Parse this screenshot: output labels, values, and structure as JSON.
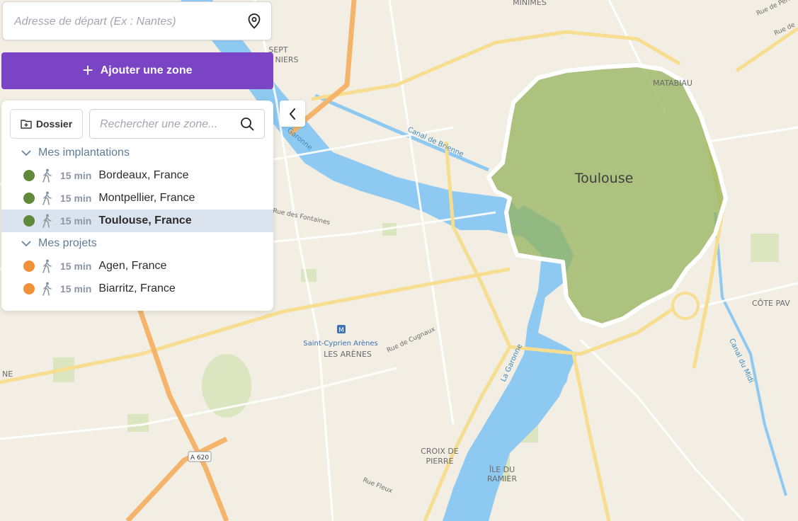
{
  "search": {
    "placeholder": "Adresse de départ (Ex : Nantes)",
    "pin_icon": "map-pin-icon"
  },
  "add_zone": {
    "label": "Ajouter une zone",
    "icon": "plus-icon"
  },
  "panel": {
    "folder_label": "Dossier",
    "zone_search_placeholder": "Rechercher une zone...",
    "groups": [
      {
        "title": "Mes implantations",
        "color": "#5e8a3a",
        "items": [
          {
            "time": "15 min",
            "city": "Bordeaux, France",
            "selected": false
          },
          {
            "time": "15 min",
            "city": "Montpellier, France",
            "selected": false
          },
          {
            "time": "15 min",
            "city": "Toulouse, France",
            "selected": true
          }
        ]
      },
      {
        "title": "Mes projets",
        "color": "#f0913a",
        "items": [
          {
            "time": "15 min",
            "city": "Agen, France",
            "selected": false
          },
          {
            "time": "15 min",
            "city": "Biarritz, France",
            "selected": false
          }
        ]
      }
    ]
  },
  "map": {
    "zone_label": "Toulouse",
    "labels": {
      "minimes": "MINIMES",
      "sept": "SEPT",
      "deniers": "NIERS",
      "matabiau": "MATABIAU",
      "canal_brienne": "Canal de Brienne",
      "garonne_north": "Garonne",
      "rue_fontaines": "Rue des Fontaines",
      "saint_cyprien": "Saint-Cyprien Arènes",
      "les_arenes": "LES ARÈNES",
      "rue_cugnaux": "Rue de Cugnaux",
      "la_garonne": "La Garonne",
      "croix_de": "CROIX DE",
      "pierre": "PIERRE",
      "ile_du": "ÎLE DU",
      "ramier": "RAMIER",
      "rue_fleux": "Rue Fleux",
      "a620": "A 620",
      "cote_pav": "CÔTE PAV",
      "canal_midi": "Canal du Midi",
      "rue_perio": "Rue de Périole",
      "rue_de": "Rue de",
      "ne": "NE"
    }
  }
}
